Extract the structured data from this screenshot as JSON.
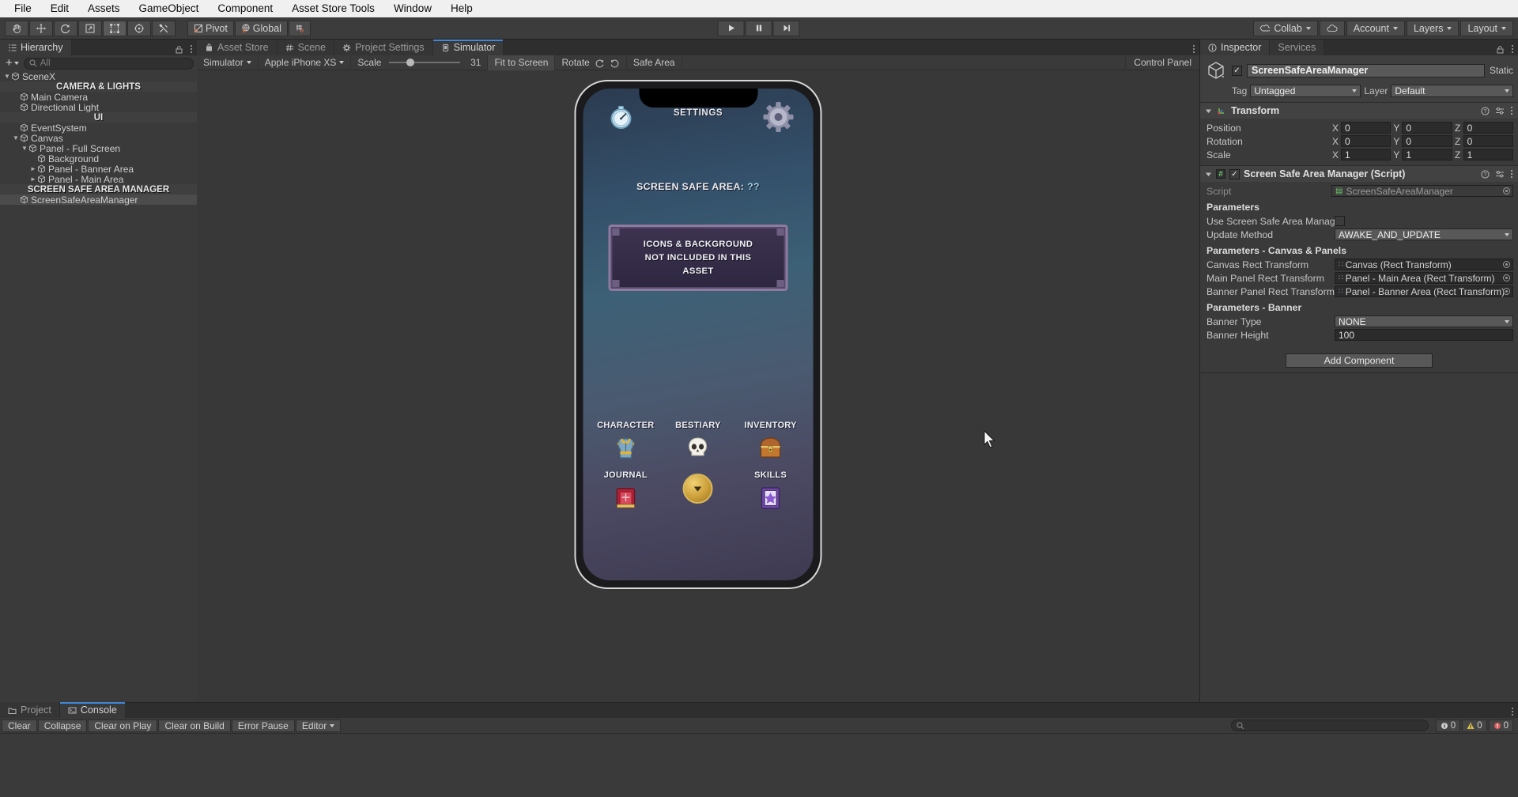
{
  "menubar": {
    "items": [
      "File",
      "Edit",
      "Assets",
      "GameObject",
      "Component",
      "Asset Store Tools",
      "Window",
      "Help"
    ]
  },
  "toolbar": {
    "tools": [
      "hand-tool",
      "move-tool",
      "rotate-tool",
      "scale-tool",
      "rect-tool",
      "transform-tool",
      "custom-tool"
    ],
    "pivot_label": "Pivot",
    "global_label": "Global",
    "play_label": "play",
    "pause_label": "pause",
    "step_label": "step",
    "collab_label": "Collab",
    "cloud_label": "cloud",
    "account_label": "Account",
    "layers_label": "Layers",
    "layout_label": "Layout"
  },
  "hierarchy": {
    "tab_label": "Hierarchy",
    "search_placeholder": "All",
    "rows": [
      {
        "label": "SceneX",
        "depth": 0,
        "type": "scene",
        "expanded": true,
        "selected": false
      },
      {
        "label": "CAMERA & LIGHTS",
        "depth": 0,
        "type": "header"
      },
      {
        "label": "Main Camera",
        "depth": 1,
        "type": "go"
      },
      {
        "label": "Directional Light",
        "depth": 1,
        "type": "go"
      },
      {
        "label": "UI",
        "depth": 0,
        "type": "header"
      },
      {
        "label": "EventSystem",
        "depth": 1,
        "type": "go"
      },
      {
        "label": "Canvas",
        "depth": 1,
        "type": "go",
        "expanded": true
      },
      {
        "label": "Panel - Full Screen",
        "depth": 2,
        "type": "go",
        "expanded": true
      },
      {
        "label": "Background",
        "depth": 3,
        "type": "go"
      },
      {
        "label": "Panel - Banner Area",
        "depth": 3,
        "type": "go",
        "collapsed": true
      },
      {
        "label": "Panel - Main Area",
        "depth": 3,
        "type": "go",
        "collapsed": true
      },
      {
        "label": "SCREEN SAFE AREA MANAGER",
        "depth": 0,
        "type": "header"
      },
      {
        "label": "ScreenSafeAreaManager",
        "depth": 1,
        "type": "go",
        "selected": true
      }
    ]
  },
  "center_tabs": [
    {
      "label": "Asset Store",
      "icon": "store-icon",
      "active": false
    },
    {
      "label": "Scene",
      "icon": "grid-icon",
      "active": false
    },
    {
      "label": "Project Settings",
      "icon": "gear-icon",
      "active": false
    },
    {
      "label": "Simulator",
      "icon": "device-icon",
      "active": true
    }
  ],
  "simulator": {
    "mode_label": "Simulator",
    "device_label": "Apple iPhone XS",
    "scale_label": "Scale",
    "scale_value": "31",
    "fit_label": "Fit to Screen",
    "rotate_label": "Rotate",
    "safe_area_label": "Safe Area",
    "control_panel_label": "Control Panel"
  },
  "game": {
    "settings_title": "SETTINGS",
    "safe_area_text": "SCREEN SAFE AREA:",
    "safe_area_value": "??",
    "notice_lines": [
      "ICONS & BACKGROUND",
      "NOT INCLUDED IN THIS",
      "ASSET"
    ],
    "menu_rows": [
      [
        {
          "label": "CHARACTER",
          "icon": "armor-icon"
        },
        {
          "label": "BESTIARY",
          "icon": "skull-icon"
        },
        {
          "label": "INVENTORY",
          "icon": "chest-icon"
        }
      ],
      [
        {
          "label": "JOURNAL",
          "icon": "book-icon"
        },
        {
          "label": "",
          "icon": "down-arrow-button"
        },
        {
          "label": "SKILLS",
          "icon": "skills-book-icon"
        }
      ]
    ]
  },
  "inspector": {
    "tabs": [
      {
        "label": "Inspector",
        "active": true
      },
      {
        "label": "Services",
        "active": false
      }
    ],
    "object_name": "ScreenSafeAreaManager",
    "static_label": "Static",
    "tag_label": "Tag",
    "tag_value": "Untagged",
    "layer_label": "Layer",
    "layer_value": "Default",
    "transform": {
      "title": "Transform",
      "rows": [
        {
          "label": "Position",
          "x": "0",
          "y": "0",
          "z": "0"
        },
        {
          "label": "Rotation",
          "x": "0",
          "y": "0",
          "z": "0"
        },
        {
          "label": "Scale",
          "x": "1",
          "y": "1",
          "z": "1"
        }
      ],
      "axes": [
        "X",
        "Y",
        "Z"
      ]
    },
    "script_component": {
      "title": "Screen Safe Area Manager (Script)",
      "script_label": "Script",
      "script_value": "ScreenSafeAreaManager",
      "sections": [
        {
          "header": "Parameters",
          "fields": [
            {
              "label": "Use Screen Safe Area Manager",
              "type": "bool",
              "value": ""
            },
            {
              "label": "Update Method",
              "type": "enum",
              "value": "AWAKE_AND_UPDATE"
            }
          ]
        },
        {
          "header": "Parameters - Canvas & Panels",
          "fields": [
            {
              "label": "Canvas Rect Transform",
              "type": "object",
              "value": "Canvas (Rect Transform)"
            },
            {
              "label": "Main Panel Rect Transform",
              "type": "object",
              "value": "Panel - Main Area (Rect Transform)"
            },
            {
              "label": "Banner Panel Rect Transform",
              "type": "object",
              "value": "Panel - Banner Area (Rect Transform)"
            }
          ]
        },
        {
          "header": "Parameters - Banner",
          "fields": [
            {
              "label": "Banner Type",
              "type": "enum",
              "value": "NONE"
            },
            {
              "label": "Banner Height",
              "type": "text",
              "value": "100"
            }
          ]
        }
      ]
    },
    "add_component_label": "Add Component"
  },
  "bottom": {
    "tabs": [
      {
        "label": "Project",
        "icon": "folder-icon",
        "active": false
      },
      {
        "label": "Console",
        "icon": "console-icon",
        "active": true
      }
    ],
    "buttons": [
      "Clear",
      "Collapse",
      "Clear on Play",
      "Clear on Build",
      "Error Pause"
    ],
    "editor_label": "Editor",
    "search_placeholder": "",
    "counters": [
      {
        "icon": "log-icon",
        "value": "0"
      },
      {
        "icon": "warning-icon",
        "value": "0"
      },
      {
        "icon": "error-icon",
        "value": "0"
      }
    ]
  },
  "colors": {
    "accent_blue": "#3f87d8",
    "panel_bg": "#3a3a3a",
    "toolbar_bg": "#3c3c3c",
    "tab_bg": "#2e2e2e",
    "field_bg": "#2b2b2b"
  }
}
